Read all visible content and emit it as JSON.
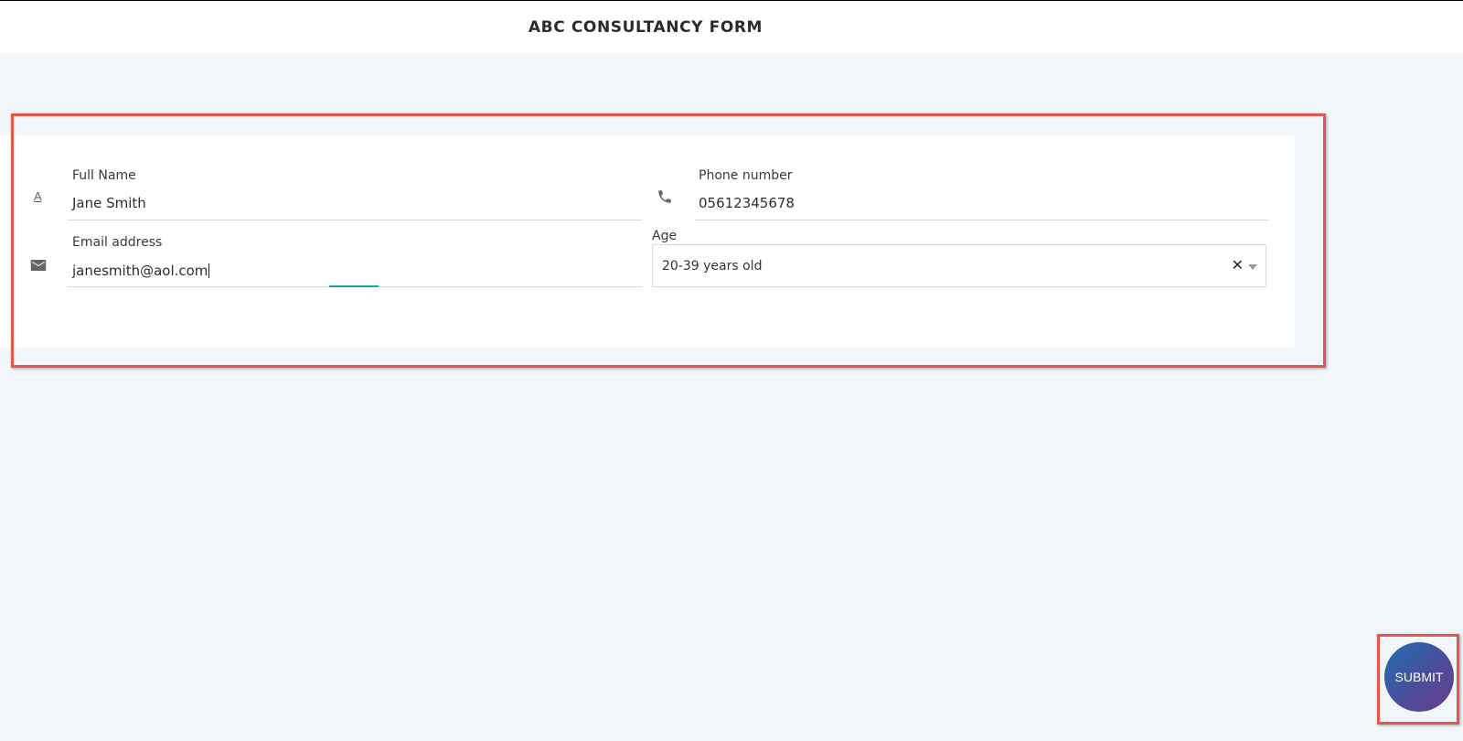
{
  "header": {
    "title": "ABC CONSULTANCY FORM"
  },
  "form": {
    "full_name": {
      "label": "Full Name",
      "value": "Jane Smith",
      "icon": "text-icon"
    },
    "phone": {
      "label": "Phone number",
      "value": "05612345678",
      "icon": "phone-icon"
    },
    "email": {
      "label": "Email address",
      "value": "janesmith@aol.com",
      "icon": "envelope-icon"
    },
    "age": {
      "label": "Age",
      "value": "20-39 years old",
      "clear_glyph": "✕"
    }
  },
  "actions": {
    "submit_label": "SUBMIT"
  },
  "colors": {
    "highlight": "#e8564a",
    "focus": "#17a2b8",
    "background": "#f1f6fa"
  }
}
